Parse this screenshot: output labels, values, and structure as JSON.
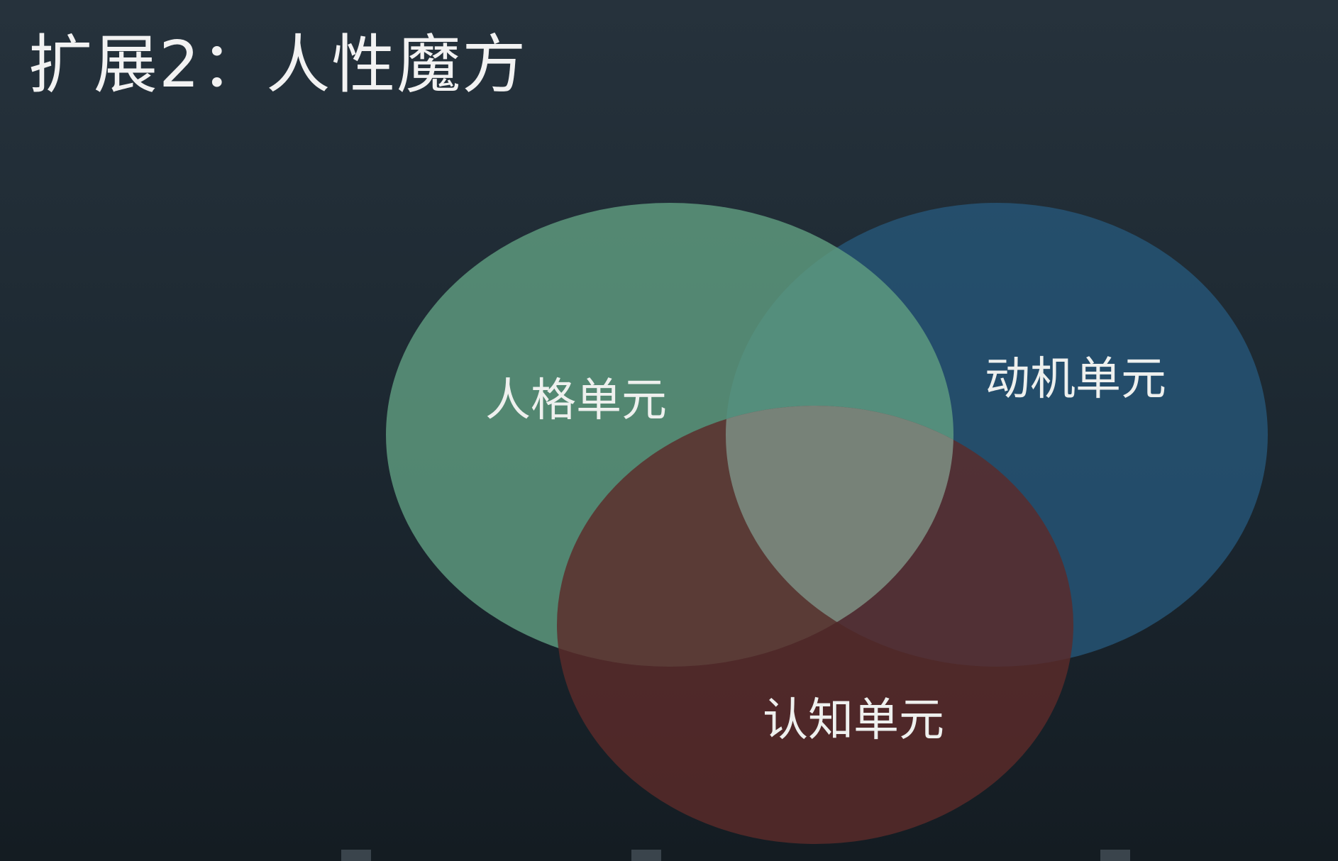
{
  "title": "扩展2：人性魔方",
  "diagram": {
    "type": "venn",
    "sets": [
      {
        "label": "人格单元",
        "color": "#5f9c80"
      },
      {
        "label": "动机单元",
        "color": "#265677"
      },
      {
        "label": "认知单元",
        "color": "#5c2b2a"
      }
    ],
    "overlap_colors": {
      "personality_motivation": "#4e9ea8",
      "center": "#7a8a80"
    }
  }
}
